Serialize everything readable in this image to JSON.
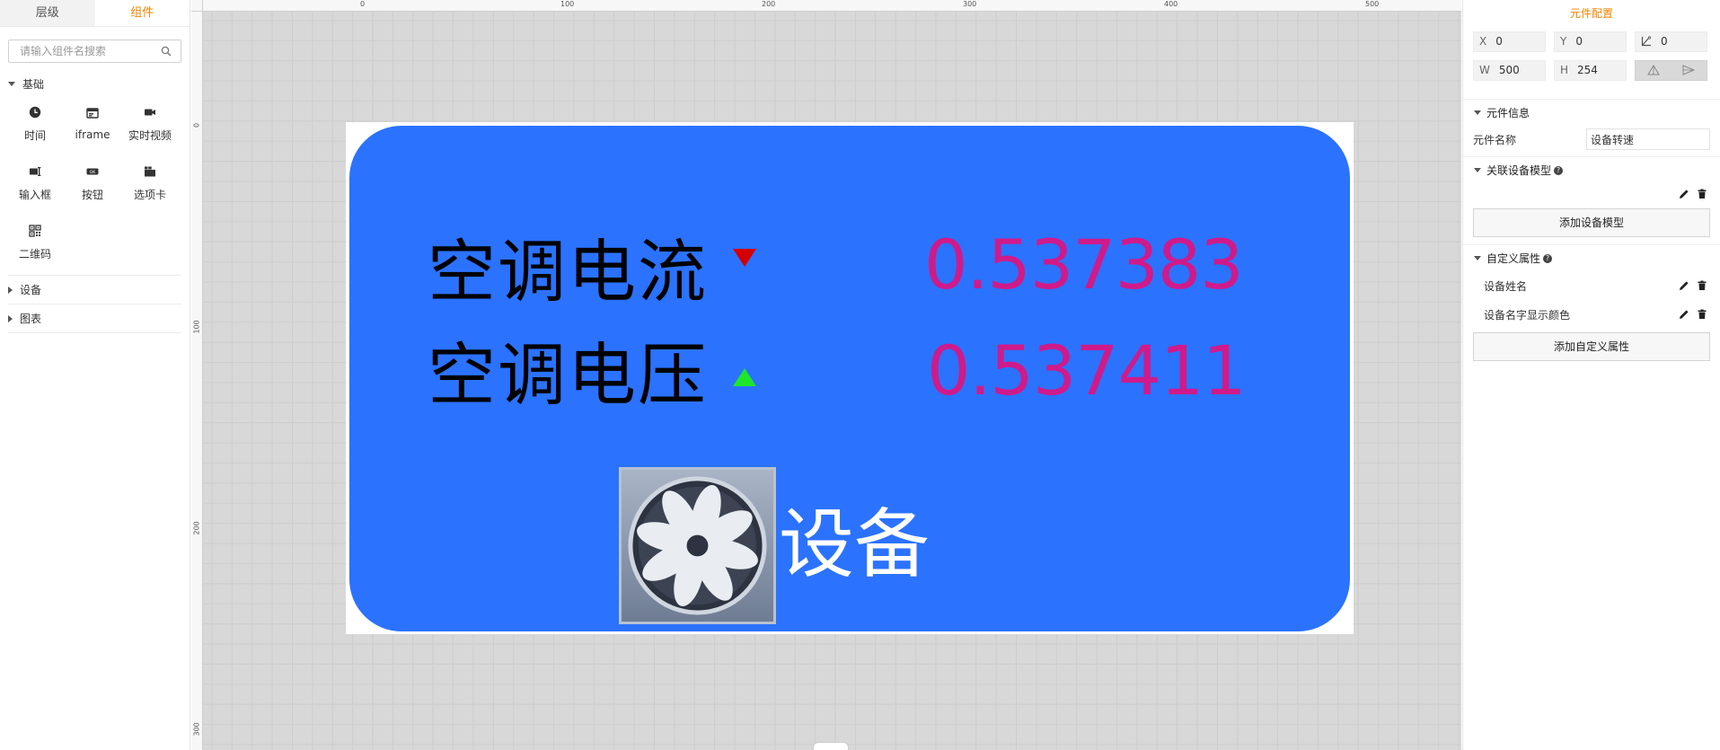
{
  "left_panel": {
    "tabs": [
      {
        "label": "层级",
        "active": false
      },
      {
        "label": "组件",
        "active": true
      }
    ],
    "search": {
      "placeholder": "请输入组件名搜索",
      "icon": "search-icon"
    },
    "groups": [
      {
        "label": "基础",
        "expanded": true,
        "items": [
          {
            "label": "时间",
            "icon": "clock-icon"
          },
          {
            "label": "iframe",
            "icon": "iframe-icon"
          },
          {
            "label": "实时视频",
            "icon": "video-camera-icon"
          },
          {
            "label": "输入框",
            "icon": "input-box-icon"
          },
          {
            "label": "按钮",
            "icon": "ok-button-icon"
          },
          {
            "label": "选项卡",
            "icon": "tabs-icon"
          },
          {
            "label": "二维码",
            "icon": "qrcode-icon"
          }
        ]
      },
      {
        "label": "设备",
        "expanded": false
      },
      {
        "label": "图表",
        "expanded": false
      }
    ]
  },
  "canvas": {
    "ruler_top": [
      "0",
      "100",
      "200",
      "300",
      "400",
      "500"
    ],
    "ruler_left": [
      "0",
      "100",
      "200",
      "300"
    ],
    "widget": {
      "background_color": "#2b72ff",
      "rows": [
        {
          "label": "空调电流",
          "trend": "down",
          "value": "0.537383"
        },
        {
          "label": "空调电压",
          "trend": "up",
          "value": "0.537411"
        }
      ],
      "device_icon": "fan-icon",
      "device_text": "设备",
      "value_color": "#d01a8a"
    }
  },
  "right_panel": {
    "title": "元件配置",
    "position": {
      "x_label": "X",
      "x": "0",
      "y_label": "Y",
      "y": "0",
      "angle": "0"
    },
    "size": {
      "w_label": "W",
      "w": "500",
      "h_label": "H",
      "h": "254"
    },
    "sections": {
      "info": {
        "title": "元件信息",
        "name_label": "元件名称",
        "name_value": "设备转速"
      },
      "device_model": {
        "title": "关联设备模型",
        "add_button": "添加设备模型"
      },
      "custom_props": {
        "title": "自定义属性",
        "items": [
          "设备姓名",
          "设备名字显示颜色"
        ],
        "add_button": "添加自定义属性"
      }
    },
    "accent_color": "#f08300"
  }
}
